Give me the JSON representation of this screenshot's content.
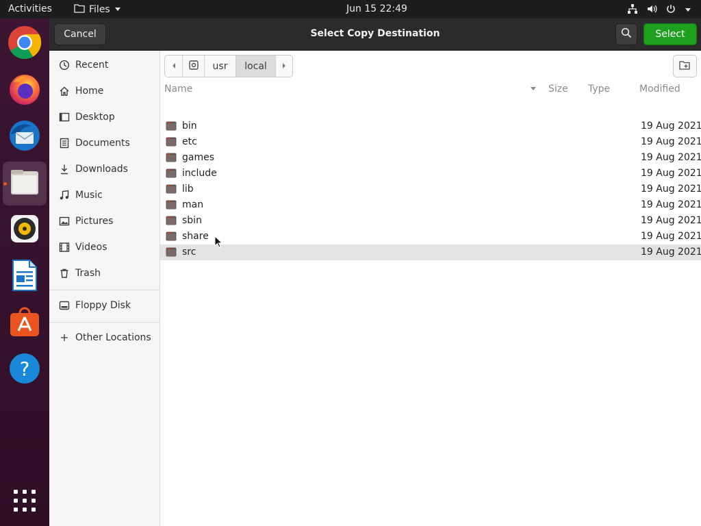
{
  "topbar": {
    "activities": "Activities",
    "app_menu": "Files",
    "clock": "Jun 15  22:49"
  },
  "dock": {
    "apps": [
      "Chrome",
      "Firefox",
      "Thunderbird",
      "Files",
      "Rhythmbox",
      "LibreOffice Writer",
      "Ubuntu Software",
      "Help"
    ],
    "active": "Files"
  },
  "dialog": {
    "title": "Select Copy Destination",
    "cancel_label": "Cancel",
    "select_label": "Select"
  },
  "sidebar": {
    "items": [
      {
        "label": "Recent",
        "icon": "clock-icon"
      },
      {
        "label": "Home",
        "icon": "home-icon"
      },
      {
        "label": "Desktop",
        "icon": "desktop-icon"
      },
      {
        "label": "Documents",
        "icon": "document-icon"
      },
      {
        "label": "Downloads",
        "icon": "download-icon"
      },
      {
        "label": "Music",
        "icon": "music-icon"
      },
      {
        "label": "Pictures",
        "icon": "picture-icon"
      },
      {
        "label": "Videos",
        "icon": "video-icon"
      },
      {
        "label": "Trash",
        "icon": "trash-icon"
      }
    ],
    "devices": [
      {
        "label": "Floppy Disk",
        "icon": "drive-icon"
      }
    ],
    "other": {
      "label": "Other Locations",
      "icon": "plus-icon"
    }
  },
  "pathbar": {
    "segments": [
      "usr",
      "local"
    ],
    "current": "local"
  },
  "columns": {
    "name": "Name",
    "size": "Size",
    "type": "Type",
    "modified": "Modified"
  },
  "files": [
    {
      "name": "bin",
      "modified": "19 Aug 2021"
    },
    {
      "name": "etc",
      "modified": "19 Aug 2021"
    },
    {
      "name": "games",
      "modified": "19 Aug 2021"
    },
    {
      "name": "include",
      "modified": "19 Aug 2021"
    },
    {
      "name": "lib",
      "modified": "19 Aug 2021"
    },
    {
      "name": "man",
      "modified": "19 Aug 2021"
    },
    {
      "name": "sbin",
      "modified": "19 Aug 2021"
    },
    {
      "name": "share",
      "modified": "19 Aug 2021"
    },
    {
      "name": "src",
      "modified": "19 Aug 2021"
    }
  ],
  "selected_file": "src",
  "colors": {
    "select_button": "#1e9f1e",
    "headerbar": "#2b2b2b",
    "folder": "#7a5a5a",
    "accent": "#e95420"
  }
}
